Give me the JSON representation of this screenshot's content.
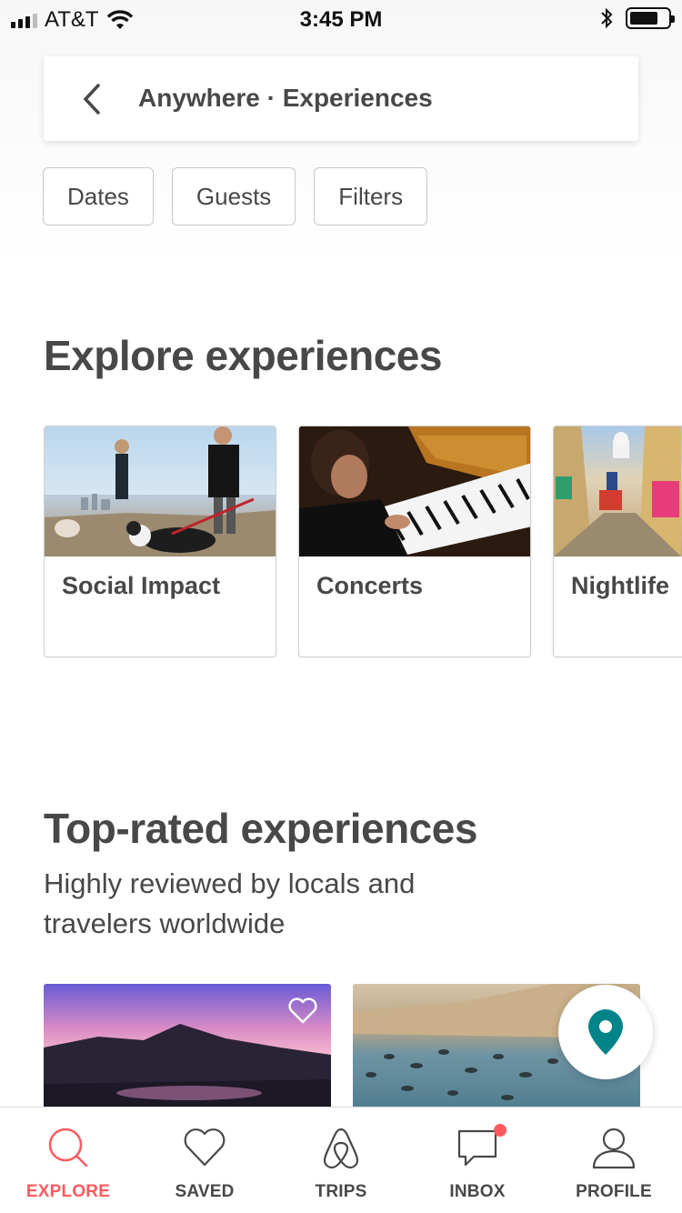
{
  "status_bar": {
    "carrier": "AT&T",
    "time": "3:45 PM"
  },
  "search": {
    "title": "Anywhere · Experiences"
  },
  "filters": [
    "Dates",
    "Guests",
    "Filters"
  ],
  "explore": {
    "heading": "Explore experiences",
    "categories": [
      {
        "label": "Social Impact"
      },
      {
        "label": "Concerts"
      },
      {
        "label": "Nightlife"
      }
    ]
  },
  "top_rated": {
    "heading": "Top-rated experiences",
    "subtitle": "Highly reviewed by locals and travelers worldwide"
  },
  "tabbar": {
    "items": [
      {
        "label": "EXPLORE",
        "icon": "search-icon",
        "active": true
      },
      {
        "label": "SAVED",
        "icon": "heart-icon"
      },
      {
        "label": "TRIPS",
        "icon": "airbnb-logo-icon"
      },
      {
        "label": "INBOX",
        "icon": "chat-bubble-icon",
        "badge": true
      },
      {
        "label": "PROFILE",
        "icon": "person-icon"
      }
    ]
  },
  "colors": {
    "accent": "#ff5a5f",
    "map_pin": "#008489",
    "text": "#484848"
  }
}
